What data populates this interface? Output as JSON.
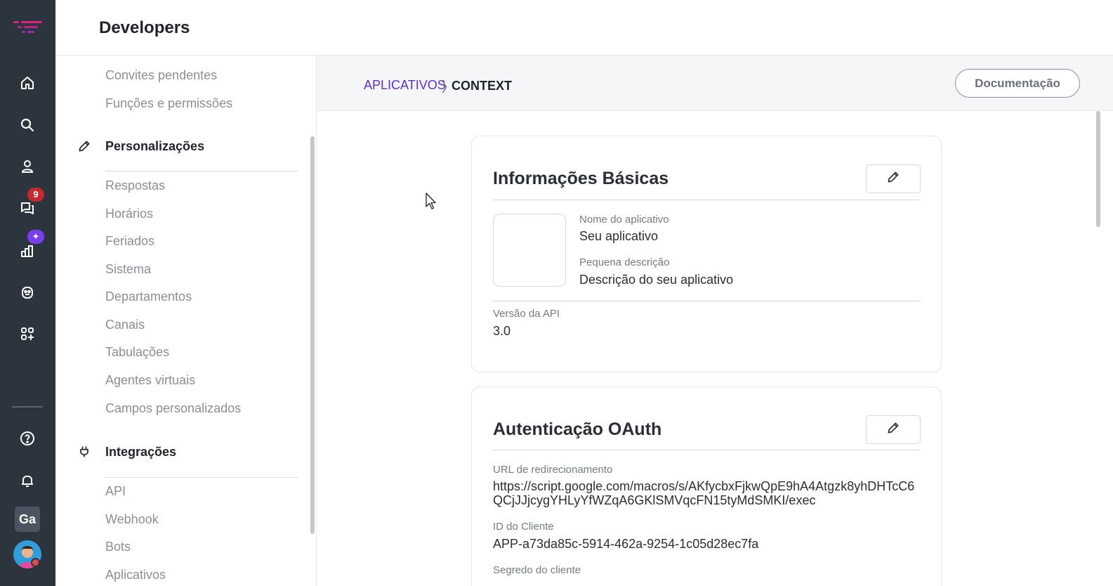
{
  "header": {
    "title": "Developers"
  },
  "rail": {
    "icons": [
      "logo-icon",
      "home-icon",
      "search-icon",
      "contacts-icon",
      "chat-icon",
      "reports-icon",
      "bot-icon",
      "apps-icon",
      "help-icon",
      "bell-icon"
    ],
    "chat_badge": "9",
    "reports_badge": "✦",
    "workspace_initials": "Ga",
    "brand_color": "#e0237a"
  },
  "sidenav": {
    "top_links": [
      "Convites pendentes",
      "Funções e permissões"
    ],
    "sections": [
      {
        "label": "Personalizações",
        "icon": "pencil-icon",
        "items": [
          "Respostas",
          "Horários",
          "Feriados",
          "Sistema",
          "Departamentos",
          "Canais",
          "Tabulações",
          "Agentes virtuais",
          "Campos personalizados"
        ]
      },
      {
        "label": "Integrações",
        "icon": "plug-icon",
        "items": [
          "API",
          "Webhook",
          "Bots",
          "Aplicativos"
        ]
      }
    ]
  },
  "toolbar": {
    "breadcrumb_link": "APLICATIVOS",
    "breadcrumb_sep": "〉",
    "breadcrumb_current": "CONTEXT",
    "docs_button": "Documentação"
  },
  "basic_info": {
    "title": "Informações Básicas",
    "app_name_label": "Nome do aplicativo",
    "app_name_value": "Seu aplicativo",
    "short_desc_label": "Pequena descrição",
    "short_desc_value": "Descrição do seu aplicativo",
    "api_version_label": "Versão da API",
    "api_version_value": "3.0"
  },
  "oauth": {
    "title": "Autenticação OAuth",
    "redirect_url_label": "URL de redirecionamento",
    "redirect_url_value": "https://script.google.com/macros/s/AKfycbxFjkwQpE9hA4Atgzk8yhDHTcC6QCjJJjcygYHLyYfWZqA6GKlSMVqcFN15tyMdSMKI/exec",
    "client_id_label": "ID do Cliente",
    "client_id_value": "APP-a73da85c-5914-462a-9254-1c05d28ec7fa",
    "client_secret_label": "Segredo do cliente"
  },
  "colors": {
    "rail_bg": "#2c343e",
    "accent_link": "#5b2ee0",
    "badge_red": "#c7282d",
    "badge_purple": "#7b3ff2"
  }
}
